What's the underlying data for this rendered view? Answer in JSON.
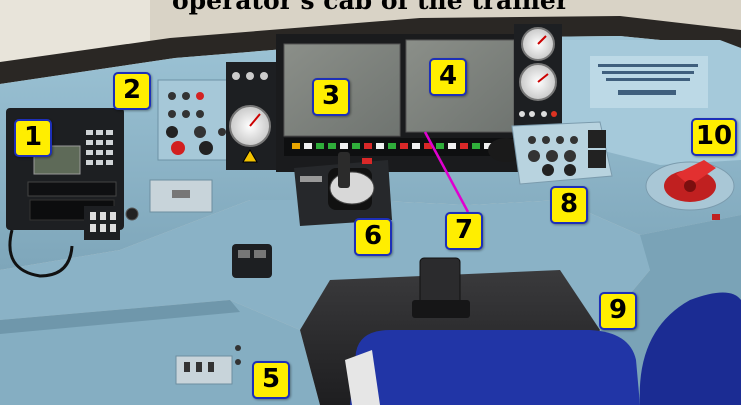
{
  "caption": "operator's cab of the trainer",
  "markers": [
    {
      "id": "1",
      "label": "1"
    },
    {
      "id": "2",
      "label": "2"
    },
    {
      "id": "3",
      "label": "3"
    },
    {
      "id": "4",
      "label": "4"
    },
    {
      "id": "5",
      "label": "5"
    },
    {
      "id": "6",
      "label": "6"
    },
    {
      "id": "7",
      "label": "7"
    },
    {
      "id": "8",
      "label": "8"
    },
    {
      "id": "9",
      "label": "9"
    },
    {
      "id": "10",
      "label": "10"
    }
  ],
  "colors": {
    "console_body": "#8fb6c9",
    "console_shadow": "#6f97ab",
    "dark_panel": "#1d1f22",
    "seat": "#1f2f9a",
    "marker_fill": "#ffee00",
    "marker_border": "#1d2fb8",
    "pointer_line": "#e000d0",
    "brake_handle": "#d42020"
  }
}
